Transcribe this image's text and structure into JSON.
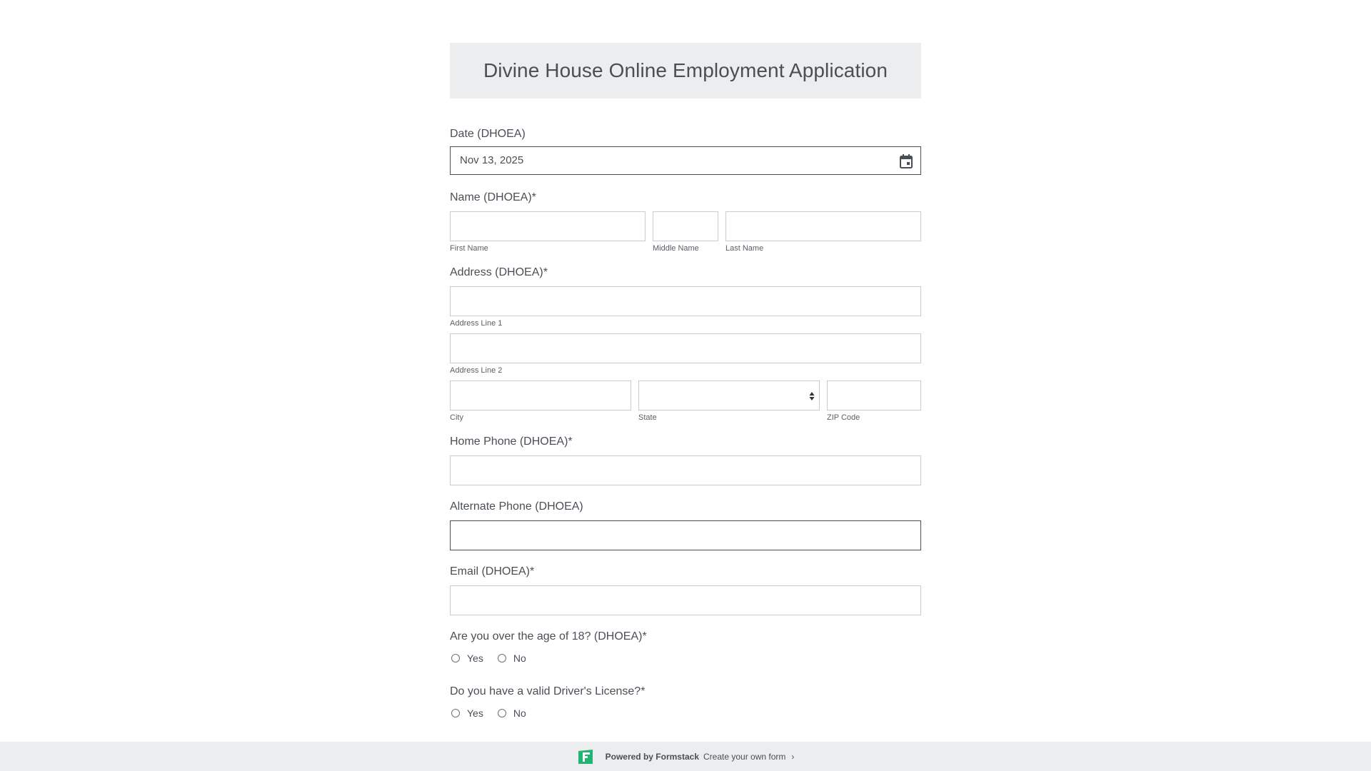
{
  "form": {
    "title": "Divine House Online Employment Application",
    "date": {
      "label": "Date (DHOEA)",
      "value": "Nov 13, 2025",
      "icon": "calendar-icon"
    },
    "name": {
      "label": "Name (DHOEA)*",
      "first": "First Name",
      "middle": "Middle Name",
      "last": "Last Name"
    },
    "address": {
      "label": "Address (DHOEA)*",
      "line1": "Address Line 1",
      "line2": "Address Line 2",
      "city": "City",
      "state": "State",
      "zip": "ZIP Code"
    },
    "home_phone": {
      "label": "Home Phone (DHOEA)*"
    },
    "alt_phone": {
      "label": "Alternate Phone (DHOEA)"
    },
    "email": {
      "label": "Email (DHOEA)*"
    },
    "age_question": {
      "label": "Are you over the age of 18? (DHOEA)*",
      "options": [
        "Yes",
        "No"
      ]
    },
    "license_question": {
      "label": "Do you have a valid Driver's License?*",
      "options": [
        "Yes",
        "No"
      ]
    }
  },
  "footer": {
    "powered_by": "Powered by Formstack",
    "create_link": "Create your own form",
    "chevron": "›"
  },
  "colors": {
    "text": "#4a4f55",
    "header_bg": "#ebedef",
    "border": "#c9ccd0",
    "brand_green": "#21b573"
  }
}
